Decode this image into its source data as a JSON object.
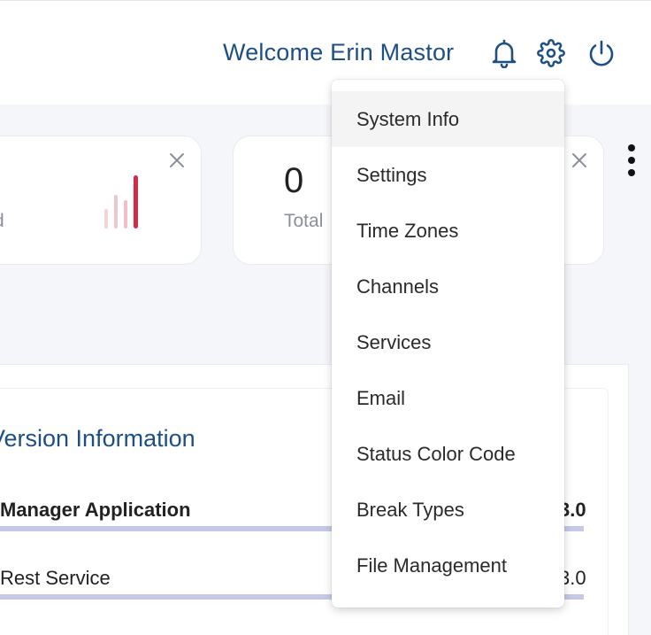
{
  "header": {
    "welcome_text": "Welcome Erin Mastor",
    "icons": [
      "bell-icon",
      "gear-icon",
      "power-icon"
    ],
    "accent_color": "#1d4f86"
  },
  "cards": [
    {
      "label": "d"
    },
    {
      "number": "0",
      "label": "Total"
    }
  ],
  "settings_menu": {
    "items": [
      {
        "label": "System Info",
        "active": true
      },
      {
        "label": "Settings"
      },
      {
        "label": "Time Zones"
      },
      {
        "label": "Channels"
      },
      {
        "label": "Services"
      },
      {
        "label": "Email"
      },
      {
        "label": "Status Color Code"
      },
      {
        "label": "Break Types"
      },
      {
        "label": "File Management"
      }
    ]
  },
  "version_panel": {
    "title": "Version Information",
    "rows": [
      {
        "label": "Manager Application",
        "value": "3.0"
      },
      {
        "label": "Rest Service",
        "value": "3.0"
      }
    ]
  }
}
